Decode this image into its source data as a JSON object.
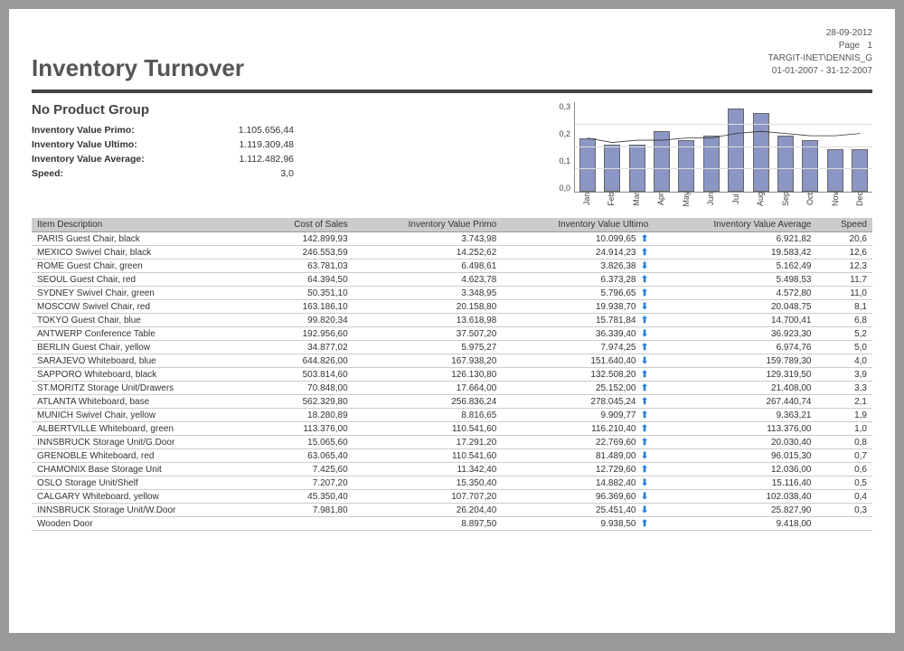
{
  "meta": {
    "date": "28-09-2012",
    "page_label": "Page",
    "page_num": "1",
    "user": "TARGIT-INET\\DENNIS_G",
    "range": "01-01-2007 - 31-12-2007"
  },
  "title": "Inventory Turnover",
  "group_title": "No Product Group",
  "summary": {
    "primo_label": "Inventory Value Primo:",
    "primo_value": "1.105.656,44",
    "ultimo_label": "Inventory Value Ultimo:",
    "ultimo_value": "1.119.309,48",
    "avg_label": "Inventory Value Average:",
    "avg_value": "1.112.482,96",
    "speed_label": "Speed:",
    "speed_value": "3,0"
  },
  "chart_data": {
    "type": "bar",
    "categories": [
      "Jan",
      "Feb",
      "Mar",
      "Apr",
      "May",
      "Jun",
      "Jul",
      "Aug",
      "Sep",
      "Oct",
      "Nov",
      "Dec"
    ],
    "bars": [
      0.24,
      0.21,
      0.21,
      0.27,
      0.23,
      0.25,
      0.37,
      0.35,
      0.25,
      0.23,
      0.19,
      0.19
    ],
    "line": [
      0.24,
      0.22,
      0.23,
      0.23,
      0.24,
      0.24,
      0.26,
      0.27,
      0.26,
      0.25,
      0.25,
      0.26
    ],
    "yticks": [
      "0,3",
      "0,2",
      "0,1",
      "0,0"
    ],
    "ylim": [
      0,
      0.4
    ]
  },
  "columns": {
    "c0": "Item Description",
    "c1": "Cost of Sales",
    "c2": "Inventory Value Primo",
    "c3": "Inventory Value Ultimo",
    "c4": "Inventory Value Average",
    "c5": "Speed"
  },
  "rows": [
    {
      "desc": "PARIS Guest Chair, black",
      "cost": "142.899,93",
      "primo": "3.743,98",
      "ultimo": "10.099,65",
      "arrow": "up",
      "avg": "6.921,82",
      "speed": "20,6"
    },
    {
      "desc": "MEXICO Swivel Chair, black",
      "cost": "246.553,59",
      "primo": "14.252,62",
      "ultimo": "24.914,23",
      "arrow": "up",
      "avg": "19.583,42",
      "speed": "12,6"
    },
    {
      "desc": "ROME Guest Chair, green",
      "cost": "63.781,03",
      "primo": "6.498,61",
      "ultimo": "3.826,38",
      "arrow": "down",
      "avg": "5.162,49",
      "speed": "12,3"
    },
    {
      "desc": "SEOUL Guest Chair, red",
      "cost": "64.394,50",
      "primo": "4.623,78",
      "ultimo": "6.373,28",
      "arrow": "up",
      "avg": "5.498,53",
      "speed": "11,7"
    },
    {
      "desc": "SYDNEY Swivel Chair, green",
      "cost": "50.351,10",
      "primo": "3.348,95",
      "ultimo": "5.796,65",
      "arrow": "up",
      "avg": "4.572,80",
      "speed": "11,0"
    },
    {
      "desc": "MOSCOW Swivel Chair, red",
      "cost": "163.186,10",
      "primo": "20.158,80",
      "ultimo": "19.938,70",
      "arrow": "down",
      "avg": "20.048,75",
      "speed": "8,1"
    },
    {
      "desc": "TOKYO Guest Chair, blue",
      "cost": "99.820,34",
      "primo": "13.618,98",
      "ultimo": "15.781,84",
      "arrow": "up",
      "avg": "14.700,41",
      "speed": "6,8"
    },
    {
      "desc": "ANTWERP Conference Table",
      "cost": "192.956,60",
      "primo": "37.507,20",
      "ultimo": "36.339,40",
      "arrow": "down",
      "avg": "36.923,30",
      "speed": "5,2"
    },
    {
      "desc": "BERLIN Guest Chair, yellow",
      "cost": "34.877,02",
      "primo": "5.975,27",
      "ultimo": "7.974,25",
      "arrow": "up",
      "avg": "6.974,76",
      "speed": "5,0"
    },
    {
      "desc": "SARAJEVO Whiteboard, blue",
      "cost": "644.826,00",
      "primo": "167.938,20",
      "ultimo": "151.640,40",
      "arrow": "down",
      "avg": "159.789,30",
      "speed": "4,0"
    },
    {
      "desc": "SAPPORO Whiteboard, black",
      "cost": "503.814,60",
      "primo": "126.130,80",
      "ultimo": "132.508,20",
      "arrow": "up",
      "avg": "129.319,50",
      "speed": "3,9"
    },
    {
      "desc": "ST.MORITZ Storage Unit/Drawers",
      "cost": "70.848,00",
      "primo": "17.664,00",
      "ultimo": "25.152,00",
      "arrow": "up",
      "avg": "21.408,00",
      "speed": "3,3"
    },
    {
      "desc": "ATLANTA Whiteboard, base",
      "cost": "562.329,80",
      "primo": "256.836,24",
      "ultimo": "278.045,24",
      "arrow": "up",
      "avg": "267.440,74",
      "speed": "2,1"
    },
    {
      "desc": "MUNICH Swivel Chair, yellow",
      "cost": "18.280,89",
      "primo": "8.816,65",
      "ultimo": "9.909,77",
      "arrow": "up",
      "avg": "9.363,21",
      "speed": "1,9"
    },
    {
      "desc": "ALBERTVILLE Whiteboard, green",
      "cost": "113.376,00",
      "primo": "110.541,60",
      "ultimo": "116.210,40",
      "arrow": "up",
      "avg": "113.376,00",
      "speed": "1,0"
    },
    {
      "desc": "INNSBRUCK Storage Unit/G.Door",
      "cost": "15.065,60",
      "primo": "17.291,20",
      "ultimo": "22.769,60",
      "arrow": "up",
      "avg": "20.030,40",
      "speed": "0,8"
    },
    {
      "desc": "GRENOBLE Whiteboard, red",
      "cost": "63.065,40",
      "primo": "110.541,60",
      "ultimo": "81.489,00",
      "arrow": "down",
      "avg": "96.015,30",
      "speed": "0,7"
    },
    {
      "desc": "CHAMONIX Base Storage Unit",
      "cost": "7.425,60",
      "primo": "11.342,40",
      "ultimo": "12.729,60",
      "arrow": "up",
      "avg": "12.036,00",
      "speed": "0,6"
    },
    {
      "desc": "OSLO Storage Unit/Shelf",
      "cost": "7.207,20",
      "primo": "15.350,40",
      "ultimo": "14.882,40",
      "arrow": "down",
      "avg": "15.116,40",
      "speed": "0,5"
    },
    {
      "desc": "CALGARY Whiteboard, yellow",
      "cost": "45.350,40",
      "primo": "107.707,20",
      "ultimo": "96.369,60",
      "arrow": "down",
      "avg": "102.038,40",
      "speed": "0,4"
    },
    {
      "desc": "INNSBRUCK Storage Unit/W.Door",
      "cost": "7.981,80",
      "primo": "26.204,40",
      "ultimo": "25.451,40",
      "arrow": "down",
      "avg": "25.827,90",
      "speed": "0,3"
    },
    {
      "desc": "Wooden Door",
      "cost": "",
      "primo": "8.897,50",
      "ultimo": "9.938,50",
      "arrow": "up",
      "avg": "9.418,00",
      "speed": ""
    }
  ]
}
